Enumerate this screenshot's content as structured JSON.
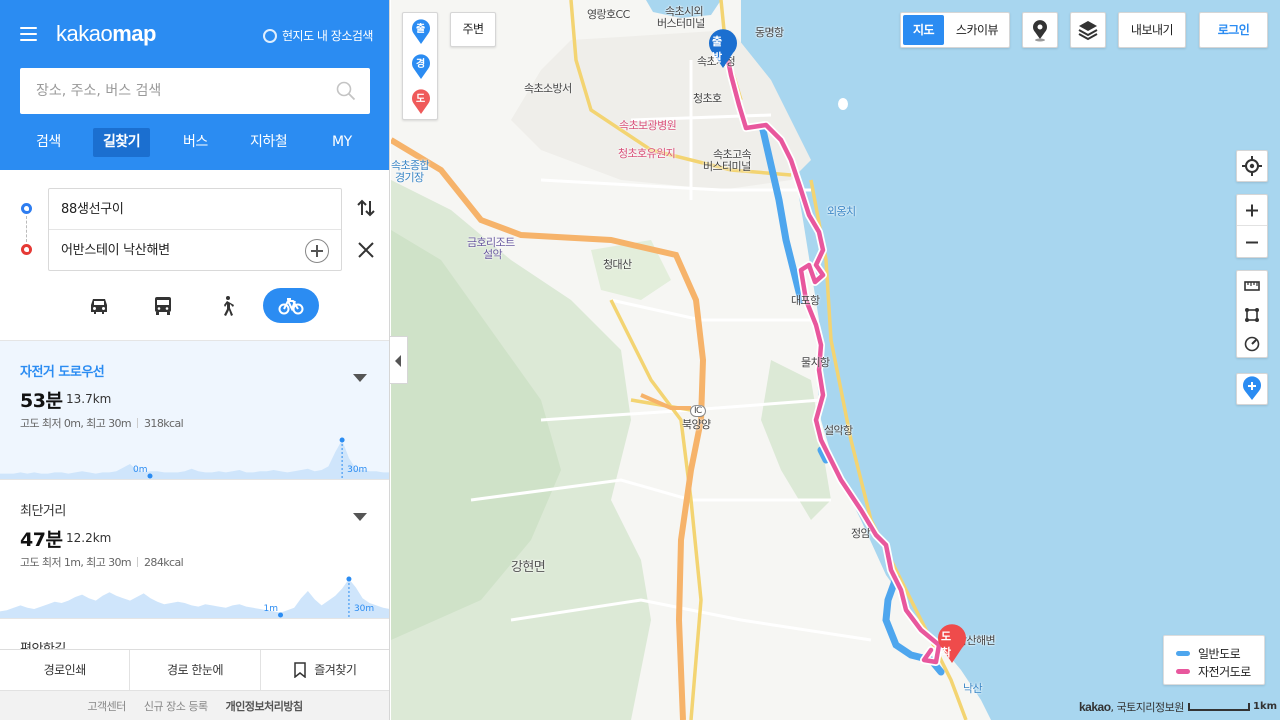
{
  "header": {
    "logo_kakao": "kakao",
    "logo_map": "map",
    "area_search_label": "현지도 내 장소검색",
    "search_placeholder": "장소, 주소, 버스 검색"
  },
  "tabs": [
    {
      "label": "검색",
      "active": false
    },
    {
      "label": "길찾기",
      "active": true
    },
    {
      "label": "버스",
      "active": false
    },
    {
      "label": "지하철",
      "active": false
    },
    {
      "label": "MY",
      "active": false
    }
  ],
  "route": {
    "origin": "88생선구이",
    "destination": "어반스테이 낙산해변"
  },
  "modes": [
    {
      "icon": "car-icon",
      "active": false
    },
    {
      "icon": "bus-icon",
      "active": false
    },
    {
      "icon": "walk-icon",
      "active": false
    },
    {
      "icon": "bicycle-icon",
      "active": true
    }
  ],
  "results": [
    {
      "name": "자전거 도로우선",
      "time": "53분",
      "distance": "13.7km",
      "elevation": "고도 최저 0m, 최고 30m",
      "kcal": "318kcal",
      "min_label": "0m",
      "max_label": "30m",
      "selected": true,
      "profile": [
        2,
        2,
        2,
        3,
        2,
        3,
        2,
        2,
        3,
        3,
        2,
        3,
        4,
        3,
        2,
        3,
        3,
        4,
        7,
        10,
        5,
        3,
        4,
        4,
        3,
        3,
        3,
        4,
        6,
        4,
        3,
        3,
        4,
        3,
        4,
        5,
        3,
        3,
        4,
        4,
        5,
        4,
        3,
        4,
        5,
        6,
        4,
        5,
        8,
        20,
        30,
        15,
        6,
        5,
        4,
        4,
        3,
        3
      ]
    },
    {
      "name": "최단거리",
      "time": "47분",
      "distance": "12.2km",
      "elevation": "고도 최저 1m, 최고 30m",
      "kcal": "284kcal",
      "min_label": "1m",
      "max_label": "30m",
      "selected": false,
      "profile": [
        3,
        4,
        6,
        8,
        6,
        5,
        7,
        9,
        11,
        10,
        12,
        15,
        17,
        14,
        12,
        16,
        19,
        16,
        14,
        12,
        15,
        18,
        14,
        11,
        9,
        10,
        11,
        10,
        8,
        7,
        9,
        8,
        7,
        6,
        8,
        9,
        7,
        6,
        5,
        4,
        3,
        2,
        4,
        6,
        14,
        20,
        13,
        8,
        12,
        16,
        22,
        30,
        23,
        14,
        10,
        8,
        6,
        5
      ]
    }
  ],
  "next_route_name": "편안한길",
  "bottom_actions": {
    "print": "경로인쇄",
    "overview": "경로 한눈에",
    "favorite": "즐겨찾기"
  },
  "footer": {
    "support": "고객센터",
    "register": "신규 장소 등록",
    "privacy": "개인정보처리방침"
  },
  "map": {
    "pins_left": {
      "start": "출",
      "via": "경",
      "end": "도"
    },
    "nearby_button": "주변",
    "map_type": {
      "map": "지도",
      "skyview": "스카이뷰"
    },
    "export_button": "내보내기",
    "login_button": "로그인",
    "start_pin": "출발",
    "end_pin": "도착",
    "legend": {
      "general": "일반도로",
      "bike": "자전거도로"
    },
    "copyright_brand": "kakao",
    "copyright_text": ", 국토지리정보원",
    "scale": "1km",
    "labels": {
      "yeongnangho": "영랑호CC",
      "sokcho_bus": "속초시외",
      "sokcho_bus2": "버스터미널",
      "city_hall": "속초시청",
      "dongmyeong": "동명항",
      "fire": "속초소방서",
      "cheongchoho": "청초호",
      "hospital": "속초보광병원",
      "park": "청초호유원지",
      "express": "속초고속",
      "express2": "버스터미널",
      "stadium": "속초종합",
      "stadium2": "경기장",
      "resort": "금호리조트",
      "resort2": "설악",
      "daesan": "청대산",
      "oeongchi": "외옹치",
      "daepo": "대포항",
      "mulchi": "물치항",
      "seorak": "설악항",
      "ic": "IC",
      "bukyangyang": "북양양",
      "jeongam": "정암",
      "hyeonmyeon": "강현면",
      "naksan": "낙산",
      "naksan_beach": "낙산해변"
    }
  }
}
